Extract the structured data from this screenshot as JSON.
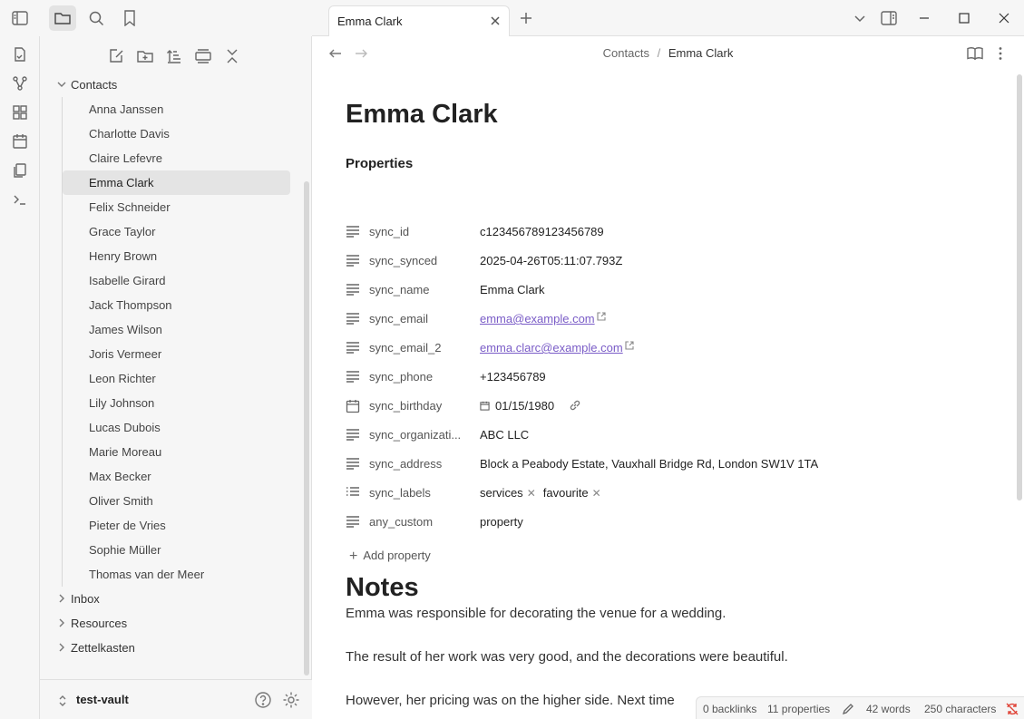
{
  "sidebar": {
    "folders": [
      {
        "name": "Contacts",
        "expanded": true
      },
      {
        "name": "Inbox",
        "expanded": false
      },
      {
        "name": "Resources",
        "expanded": false
      },
      {
        "name": "Zettelkasten",
        "expanded": false
      }
    ],
    "files": [
      "Anna Janssen",
      "Charlotte Davis",
      "Claire Lefevre",
      "Emma Clark",
      "Felix Schneider",
      "Grace Taylor",
      "Henry Brown",
      "Isabelle Girard",
      "Jack Thompson",
      "James Wilson",
      "Joris Vermeer",
      "Leon Richter",
      "Lily Johnson",
      "Lucas Dubois",
      "Marie Moreau",
      "Max Becker",
      "Oliver Smith",
      "Pieter de Vries",
      "Sophie Müller",
      "Thomas van der Meer"
    ],
    "active_file": "Emma Clark",
    "vault_name": "test-vault"
  },
  "tab": {
    "title": "Emma Clark"
  },
  "breadcrumb": {
    "folder": "Contacts",
    "separator": "/",
    "current": "Emma Clark"
  },
  "note": {
    "title": "Emma Clark",
    "properties_heading": "Properties",
    "properties": [
      {
        "key": "sync_id",
        "value": "c123456789123456789",
        "icon": "text-icon"
      },
      {
        "key": "sync_synced",
        "value": "2025-04-26T05:11:07.793Z",
        "icon": "text-icon"
      },
      {
        "key": "sync_name",
        "value": "Emma Clark",
        "icon": "text-icon"
      },
      {
        "key": "sync_email",
        "value": "emma@example.com",
        "icon": "text-icon"
      },
      {
        "key": "sync_email_2",
        "value": "emma.clarc@example.com",
        "icon": "text-icon"
      },
      {
        "key": "sync_phone",
        "value": "+123456789",
        "icon": "text-icon"
      },
      {
        "key": "sync_birthday",
        "value": "01/15/1980",
        "icon": "calendar-icon"
      },
      {
        "key": "sync_organizati...",
        "value": "ABC LLC",
        "icon": "text-icon"
      },
      {
        "key": "sync_address",
        "value": "Block a Peabody Estate, Vauxhall Bridge Rd, London SW1V 1TA",
        "icon": "text-icon"
      },
      {
        "key": "sync_labels",
        "tags": [
          "services",
          "favourite"
        ],
        "icon": "list-icon"
      },
      {
        "key": "any_custom",
        "value": "property",
        "icon": "text-icon"
      }
    ],
    "add_property_label": "Add property",
    "notes_heading": "Notes",
    "paragraphs": [
      "Emma was responsible for decorating the venue for a wedding.",
      "The result of her work was very good, and the decorations were beautiful.",
      "However, her pricing was on the higher side. Next time"
    ]
  },
  "status": {
    "backlinks": "0 backlinks",
    "properties": "11 properties",
    "words": "42 words",
    "characters": "250 characters"
  },
  "colors": {
    "accent": "#7a5cc7",
    "sync_off": "#e0463a"
  }
}
